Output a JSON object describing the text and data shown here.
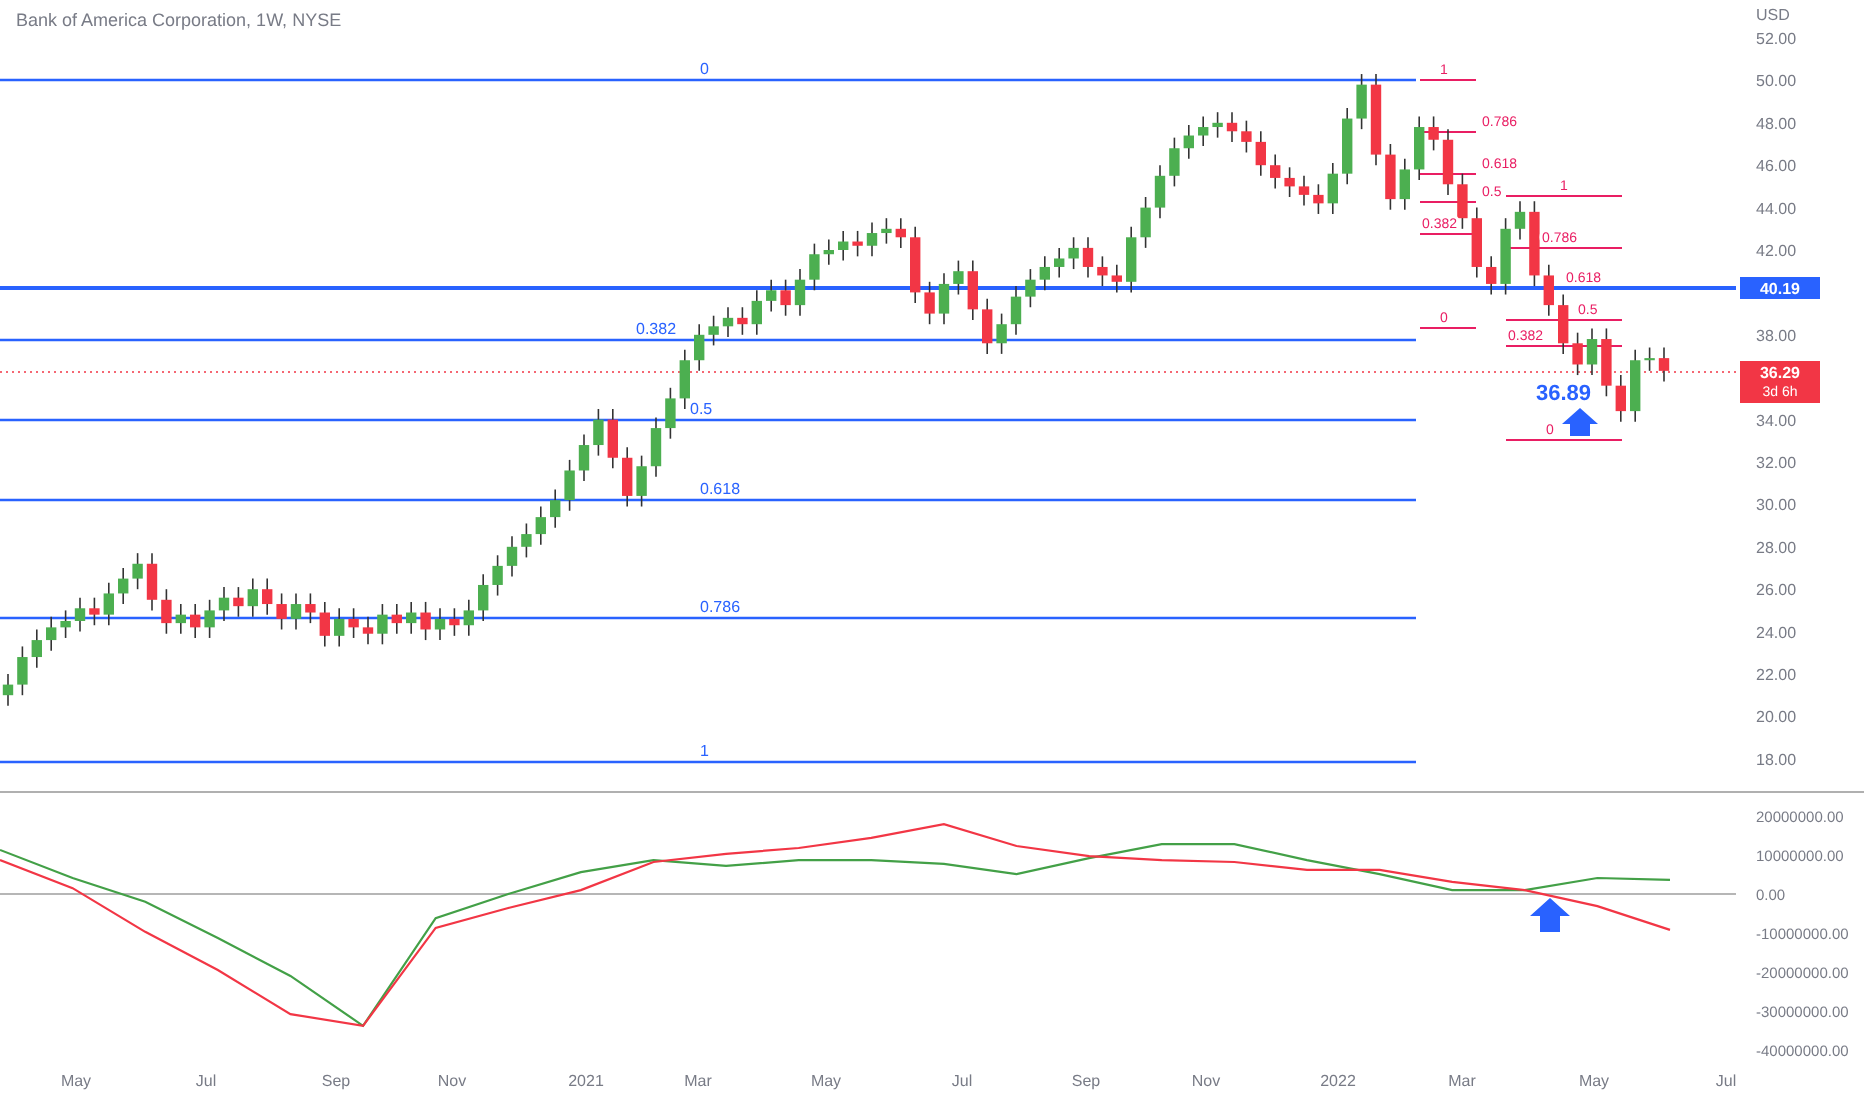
{
  "title": "Bank of America Corporation, 1W, NYSE",
  "price": {
    "unit": "USD",
    "chart_data": {
      "type": "candlestick",
      "ylim": [
        18,
        52
      ],
      "yticks": [
        {
          "value": 52,
          "label": "52.00"
        },
        {
          "value": 50,
          "label": "50.00"
        },
        {
          "value": 48,
          "label": "48.00"
        },
        {
          "value": 46,
          "label": "46.00"
        },
        {
          "value": 44,
          "label": "44.00"
        },
        {
          "value": 42,
          "label": "42.00"
        },
        {
          "value": 38,
          "label": "38.00"
        },
        {
          "value": 34,
          "label": "34.00"
        },
        {
          "value": 32,
          "label": "32.00"
        },
        {
          "value": 30,
          "label": "30.00"
        },
        {
          "value": 28,
          "label": "28.00"
        },
        {
          "value": 26,
          "label": "26.00"
        },
        {
          "value": 24,
          "label": "24.00"
        },
        {
          "value": 22,
          "label": "22.00"
        },
        {
          "value": 20,
          "label": "20.00"
        },
        {
          "value": 18,
          "label": "18.00"
        }
      ],
      "ohlc": [
        [
          21.0,
          22.0,
          20.5,
          21.5
        ],
        [
          21.5,
          23.3,
          21.0,
          22.8
        ],
        [
          22.8,
          24.1,
          22.3,
          23.6
        ],
        [
          23.6,
          24.7,
          23.1,
          24.2
        ],
        [
          24.2,
          25.0,
          23.7,
          24.5
        ],
        [
          24.5,
          25.6,
          24.0,
          25.1
        ],
        [
          25.1,
          25.6,
          24.3,
          24.8
        ],
        [
          24.8,
          26.3,
          24.3,
          25.8
        ],
        [
          25.8,
          27.0,
          25.3,
          26.5
        ],
        [
          26.5,
          27.7,
          26.0,
          27.2
        ],
        [
          27.2,
          27.7,
          25.0,
          25.5
        ],
        [
          25.5,
          26.0,
          23.9,
          24.4
        ],
        [
          24.4,
          25.3,
          23.9,
          24.8
        ],
        [
          24.8,
          25.3,
          23.7,
          24.2
        ],
        [
          24.2,
          25.5,
          23.7,
          25.0
        ],
        [
          25.0,
          26.1,
          24.5,
          25.6
        ],
        [
          25.6,
          26.1,
          24.7,
          25.2
        ],
        [
          25.2,
          26.5,
          24.7,
          26.0
        ],
        [
          26.0,
          26.5,
          24.8,
          25.3
        ],
        [
          25.3,
          25.8,
          24.1,
          24.6
        ],
        [
          24.6,
          25.8,
          24.1,
          25.3
        ],
        [
          25.3,
          25.8,
          24.4,
          24.9
        ],
        [
          24.9,
          25.4,
          23.3,
          23.8
        ],
        [
          23.8,
          25.1,
          23.3,
          24.6
        ],
        [
          24.6,
          25.1,
          23.7,
          24.2
        ],
        [
          24.2,
          24.7,
          23.4,
          23.9
        ],
        [
          23.9,
          25.3,
          23.4,
          24.8
        ],
        [
          24.8,
          25.3,
          23.9,
          24.4
        ],
        [
          24.4,
          25.4,
          23.9,
          24.9
        ],
        [
          24.9,
          25.4,
          23.6,
          24.1
        ],
        [
          24.1,
          25.1,
          23.6,
          24.6
        ],
        [
          24.6,
          25.1,
          23.8,
          24.3
        ],
        [
          24.3,
          25.5,
          23.8,
          25.0
        ],
        [
          25.0,
          26.7,
          24.5,
          26.2
        ],
        [
          26.2,
          27.6,
          25.7,
          27.1
        ],
        [
          27.1,
          28.5,
          26.6,
          28.0
        ],
        [
          28.0,
          29.1,
          27.5,
          28.6
        ],
        [
          28.6,
          29.9,
          28.1,
          29.4
        ],
        [
          29.4,
          30.7,
          28.9,
          30.2
        ],
        [
          30.2,
          32.1,
          29.7,
          31.6
        ],
        [
          31.6,
          33.3,
          31.1,
          32.8
        ],
        [
          32.8,
          34.5,
          32.3,
          34.0
        ],
        [
          34.0,
          34.5,
          31.7,
          32.2
        ],
        [
          32.2,
          32.7,
          29.9,
          30.4
        ],
        [
          30.4,
          32.3,
          29.9,
          31.8
        ],
        [
          31.8,
          34.1,
          31.3,
          33.6
        ],
        [
          33.6,
          35.5,
          33.1,
          35.0
        ],
        [
          35.0,
          37.3,
          34.5,
          36.8
        ],
        [
          36.8,
          38.5,
          36.3,
          38.0
        ],
        [
          38.0,
          38.9,
          37.5,
          38.4
        ],
        [
          38.4,
          39.3,
          37.9,
          38.8
        ],
        [
          38.8,
          39.3,
          38.0,
          38.5
        ],
        [
          38.5,
          40.1,
          38.0,
          39.6
        ],
        [
          39.6,
          40.6,
          39.1,
          40.1
        ],
        [
          40.1,
          40.6,
          38.9,
          39.4
        ],
        [
          39.4,
          41.1,
          38.9,
          40.6
        ],
        [
          40.6,
          42.3,
          40.1,
          41.8
        ],
        [
          41.8,
          42.5,
          41.3,
          42.0
        ],
        [
          42.0,
          42.9,
          41.5,
          42.4
        ],
        [
          42.4,
          42.9,
          41.7,
          42.2
        ],
        [
          42.2,
          43.3,
          41.7,
          42.8
        ],
        [
          42.8,
          43.5,
          42.3,
          43.0
        ],
        [
          43.0,
          43.5,
          42.1,
          42.6
        ],
        [
          42.6,
          43.1,
          39.5,
          40.0
        ],
        [
          40.0,
          40.5,
          38.5,
          39.0
        ],
        [
          39.0,
          40.9,
          38.5,
          40.4
        ],
        [
          40.4,
          41.5,
          39.9,
          41.0
        ],
        [
          41.0,
          41.5,
          38.7,
          39.2
        ],
        [
          39.2,
          39.7,
          37.1,
          37.6
        ],
        [
          37.6,
          39.0,
          37.1,
          38.5
        ],
        [
          38.5,
          40.3,
          38.0,
          39.8
        ],
        [
          39.8,
          41.1,
          39.3,
          40.6
        ],
        [
          40.6,
          41.7,
          40.1,
          41.2
        ],
        [
          41.2,
          42.1,
          40.7,
          41.6
        ],
        [
          41.6,
          42.6,
          41.1,
          42.1
        ],
        [
          42.1,
          42.6,
          40.7,
          41.2
        ],
        [
          41.2,
          41.7,
          40.3,
          40.8
        ],
        [
          40.8,
          41.3,
          40.0,
          40.5
        ],
        [
          40.5,
          43.1,
          40.0,
          42.6
        ],
        [
          42.6,
          44.5,
          42.1,
          44.0
        ],
        [
          44.0,
          46.0,
          43.5,
          45.5
        ],
        [
          45.5,
          47.3,
          45.0,
          46.8
        ],
        [
          46.8,
          47.9,
          46.3,
          47.4
        ],
        [
          47.4,
          48.3,
          46.9,
          47.8
        ],
        [
          47.8,
          48.5,
          47.3,
          48.0
        ],
        [
          48.0,
          48.5,
          47.1,
          47.6
        ],
        [
          47.6,
          48.1,
          46.6,
          47.1
        ],
        [
          47.1,
          47.6,
          45.5,
          46.0
        ],
        [
          46.0,
          46.5,
          44.9,
          45.4
        ],
        [
          45.4,
          45.9,
          44.5,
          45.0
        ],
        [
          45.0,
          45.5,
          44.1,
          44.6
        ],
        [
          44.6,
          45.1,
          43.7,
          44.2
        ],
        [
          44.2,
          46.1,
          43.7,
          45.6
        ],
        [
          45.6,
          48.7,
          45.1,
          48.2
        ],
        [
          48.2,
          50.3,
          47.7,
          49.8
        ],
        [
          49.8,
          50.3,
          46.0,
          46.5
        ],
        [
          46.5,
          47.0,
          43.9,
          44.4
        ],
        [
          44.4,
          46.3,
          43.9,
          45.8
        ],
        [
          45.8,
          48.3,
          45.3,
          47.8
        ],
        [
          47.8,
          48.3,
          46.7,
          47.2
        ],
        [
          47.2,
          47.7,
          44.6,
          45.1
        ],
        [
          45.1,
          45.6,
          43.0,
          43.5
        ],
        [
          43.5,
          44.0,
          40.7,
          41.2
        ],
        [
          41.2,
          41.7,
          39.9,
          40.4
        ],
        [
          40.4,
          43.5,
          39.9,
          43.0
        ],
        [
          43.0,
          44.3,
          42.5,
          43.8
        ],
        [
          43.8,
          44.3,
          40.3,
          40.8
        ],
        [
          40.8,
          41.3,
          38.9,
          39.4
        ],
        [
          39.4,
          39.9,
          37.1,
          37.6
        ],
        [
          37.6,
          38.1,
          36.1,
          36.6
        ],
        [
          36.6,
          38.3,
          36.1,
          37.8
        ],
        [
          37.8,
          38.3,
          35.1,
          35.6
        ],
        [
          35.6,
          36.1,
          33.9,
          34.4
        ],
        [
          34.4,
          37.3,
          33.9,
          36.8
        ],
        [
          36.8,
          37.4,
          36.3,
          36.9
        ],
        [
          36.9,
          37.4,
          35.8,
          36.3
        ]
      ]
    }
  },
  "level_tag": "40.19",
  "last_price": "36.29",
  "fib_main": [
    "0",
    "0.382",
    "0.5",
    "0.618",
    "0.786",
    "1"
  ],
  "fib_small_a": [
    "1",
    "0.786",
    "0.618",
    "0.5",
    "0.382",
    "0"
  ],
  "fib_small_b": [
    "1",
    "0.786",
    "0.618",
    "0.5",
    "0.382",
    "0"
  ],
  "countdown": "3d 6h",
  "annotation": "36.89",
  "oscillator": {
    "chart_data": {
      "type": "line",
      "series": [
        {
          "color": "#43a047",
          "values": [
            11300000,
            4100000,
            -2000000,
            -11300000,
            -21000000,
            -33800000,
            -6200000,
            0,
            5600000,
            8700000,
            7200000,
            8700000,
            8700000,
            7700000,
            5100000,
            9200000,
            12800000,
            12800000,
            8700000,
            5100000,
            1000000,
            1000000,
            4100000,
            3600000
          ]
        },
        {
          "color": "#f23645",
          "values": [
            8700000,
            1500000,
            -9700000,
            -19500000,
            -30800000,
            -33800000,
            -8700000,
            -3600000,
            1000000,
            8200000,
            10300000,
            11800000,
            14400000,
            17900000,
            12300000,
            9700000,
            8700000,
            8200000,
            6200000,
            6200000,
            3100000,
            1000000,
            -3100000,
            -9200000
          ]
        }
      ],
      "ylim": [
        -40000000,
        20000000
      ],
      "yticks": [
        {
          "value": 20000000,
          "label": "20000000.00"
        },
        {
          "value": 10000000,
          "label": "10000000.00"
        },
        {
          "value": 0,
          "label": "0.00"
        },
        {
          "value": -10000000,
          "label": "-10000000.00"
        },
        {
          "value": -20000000,
          "label": "-20000000.00"
        },
        {
          "value": -30000000,
          "label": "-30000000.00"
        },
        {
          "value": -40000000,
          "label": "-40000000.00"
        }
      ]
    }
  },
  "time_axis": [
    "May",
    "Jul",
    "Sep",
    "Nov",
    "2021",
    "Mar",
    "May",
    "Jul",
    "Sep",
    "Nov",
    "2022",
    "Mar",
    "May",
    "Jul"
  ]
}
